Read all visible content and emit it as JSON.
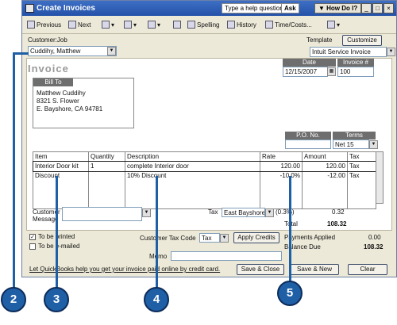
{
  "window": {
    "title": "Create Invoices",
    "help_label": "Type a help question",
    "ask_label": "Ask",
    "howdoi_label": "▼ How Do I?"
  },
  "toolbar": {
    "previous": "Previous",
    "next": "Next",
    "spelling": "Spelling",
    "history": "History",
    "time_costs": "Time/Costs..."
  },
  "header": {
    "customer_job_label": "Customer:Job",
    "customer_value": "Cuddihy, Matthew",
    "template_label": "Template",
    "customize_label": "Customize",
    "template_value": "Intuit Service Invoice",
    "invoice_title": "Invoice",
    "date_label": "Date",
    "date_value": "12/15/2007",
    "invoice_no_label": "Invoice #",
    "invoice_no_value": "100"
  },
  "bill_to": {
    "label": "Bill To",
    "line1": "Matthew Cuddihy",
    "line2": "8321 S. Flower",
    "line3": "E. Bayshore, CA  94781"
  },
  "po": {
    "label": "P.O. No.",
    "value": ""
  },
  "terms": {
    "label": "Terms",
    "value": "Net 15"
  },
  "items": {
    "columns": [
      "Item",
      "Quantity",
      "Description",
      "Rate",
      "Amount",
      "Tax"
    ],
    "rows": [
      [
        "Interior Door kit",
        "1",
        "complete Interior door",
        "120.00",
        "120.00",
        "Tax"
      ],
      [
        "Discount",
        "",
        "10% Discount",
        "-10.0%",
        "-12.00",
        "Tax"
      ]
    ]
  },
  "footer": {
    "customer_message_label1": "Customer",
    "customer_message_label2": "Message",
    "tax_label": "Tax",
    "tax_value": "East Bayshore",
    "tax_rate": "(0.3%)",
    "tax_amount": "0.32",
    "total_label": "Total",
    "total_value": "108.32",
    "to_be_printed": "To be printed",
    "to_be_emailed": "To be e-mailed",
    "customer_tax_code_label": "Customer Tax Code",
    "tax_code_value": "Tax",
    "apply_credits": "Apply Credits",
    "payments_applied_label": "Payments Applied",
    "payments_applied_value": "0.00",
    "balance_due_label": "Balance Due",
    "balance_due_value": "108.32",
    "memo_label": "Memo",
    "online_link": "Let QuickBooks help you get your invoice paid online by credit card.",
    "save_close": "Save & Close",
    "save_new": "Save & New",
    "clear": "Clear"
  },
  "callouts": [
    "2",
    "3",
    "4",
    "5"
  ],
  "colors": {
    "callout": "#1e5fa6",
    "titlebar": "#2452a8",
    "window_bg": "#ece9d8"
  }
}
